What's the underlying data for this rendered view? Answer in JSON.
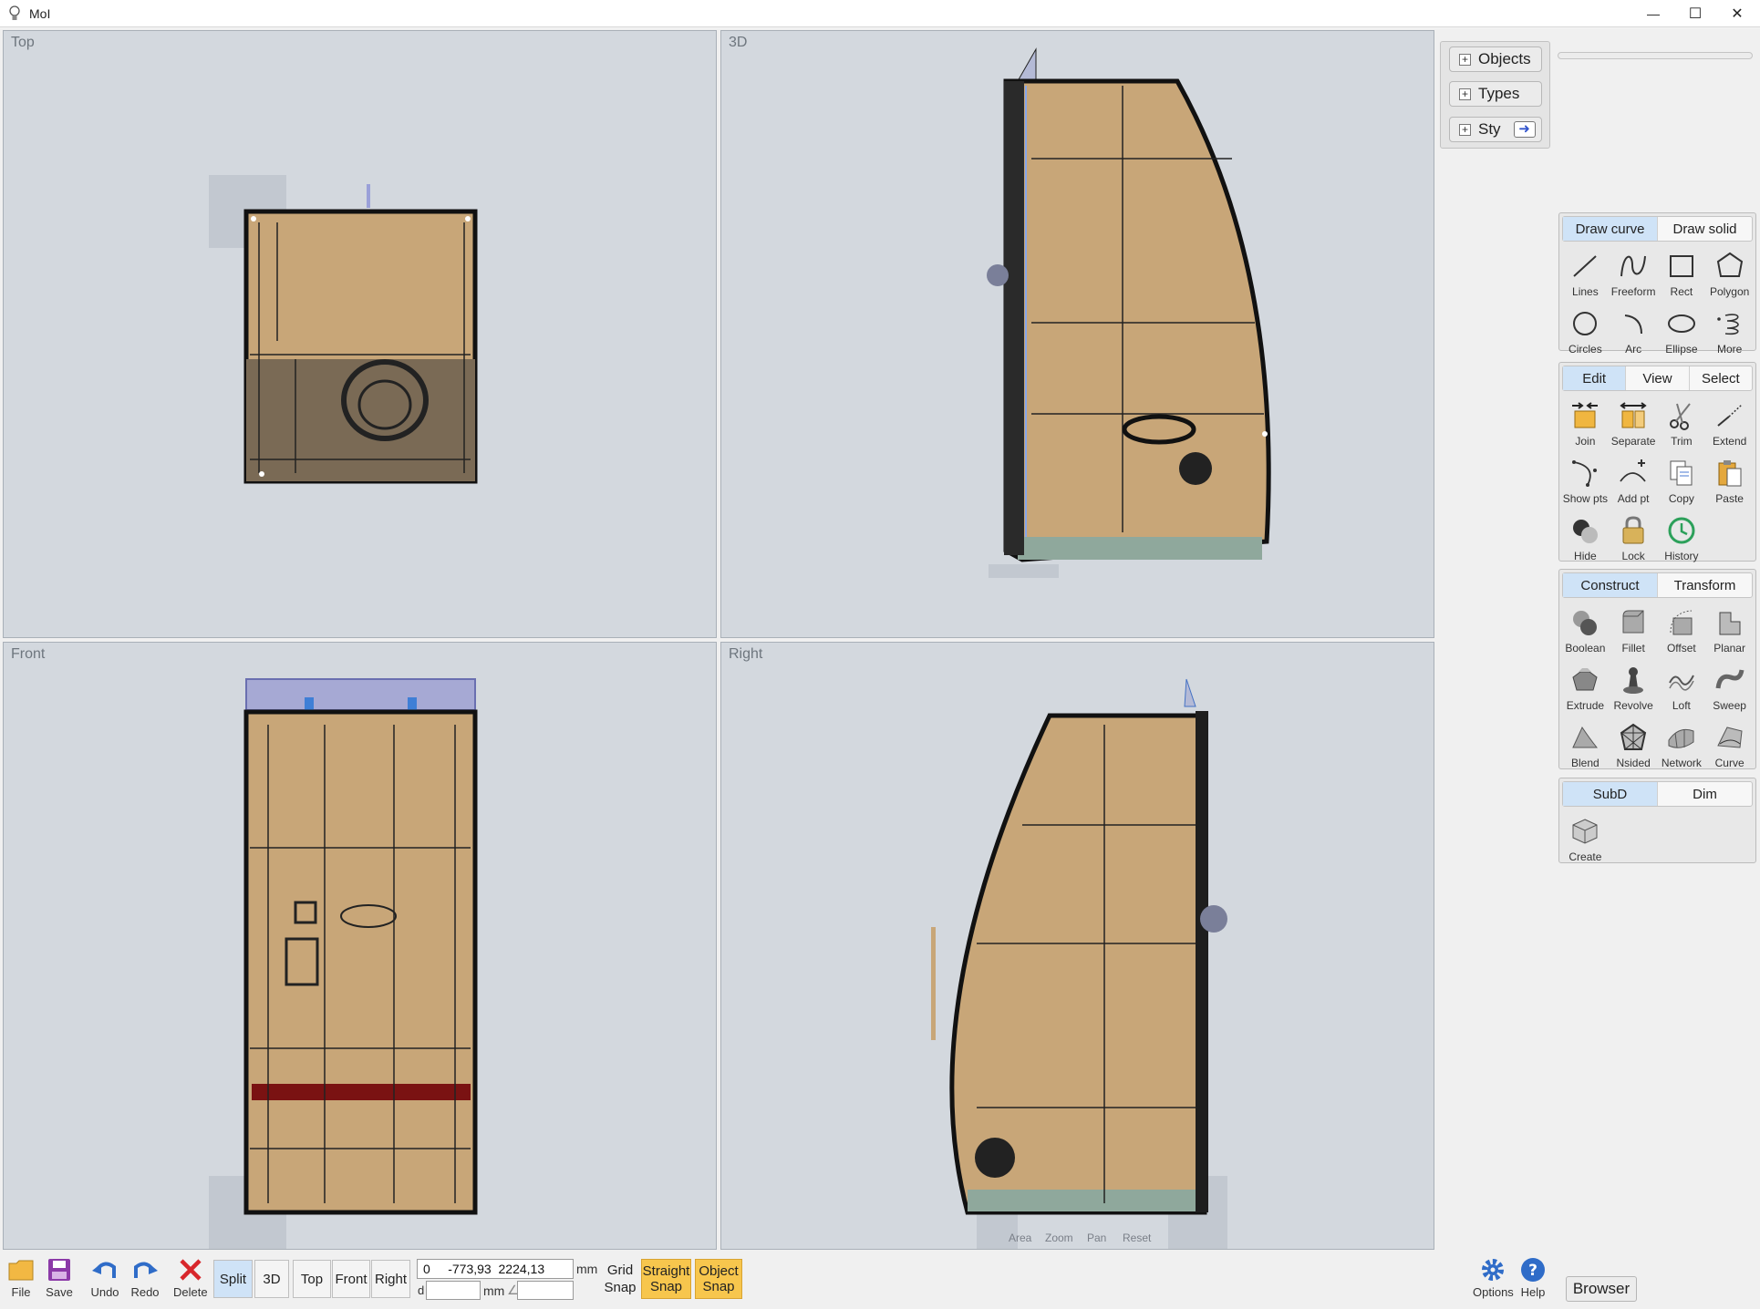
{
  "app": {
    "title": "MoI"
  },
  "window_controls": {
    "minimize": "—",
    "maximize": "☐",
    "close": "✕"
  },
  "viewports": {
    "top": {
      "label": "Top"
    },
    "perspective": {
      "label": "3D"
    },
    "front": {
      "label": "Front"
    },
    "right": {
      "label": "Right"
    }
  },
  "nav_hints": {
    "area": "Area",
    "zoom": "Zoom",
    "pan": "Pan",
    "reset": "Reset"
  },
  "scene_browser": {
    "objects": "Objects",
    "types": "Types",
    "styles": "Sty"
  },
  "draw_palette": {
    "tabs": [
      "Draw curve",
      "Draw solid"
    ],
    "active_tab": "Draw curve",
    "tools": [
      "Lines",
      "Freeform",
      "Rect",
      "Polygon",
      "Circles",
      "Arc",
      "Ellipse",
      "More"
    ]
  },
  "edit_palette": {
    "tabs": [
      "Edit",
      "View",
      "Select"
    ],
    "active_tab": "Edit",
    "tools": [
      "Join",
      "Separate",
      "Trim",
      "Extend",
      "Show pts",
      "Add pt",
      "Copy",
      "Paste",
      "Hide",
      "Lock",
      "History"
    ]
  },
  "construct_palette": {
    "tabs": [
      "Construct",
      "Transform"
    ],
    "active_tab": "Construct",
    "tools": [
      "Boolean",
      "Fillet",
      "Offset",
      "Planar",
      "Extrude",
      "Revolve",
      "Loft",
      "Sweep",
      "Blend",
      "Nsided",
      "Network",
      "Curve"
    ]
  },
  "subd_palette": {
    "tabs": [
      "SubD",
      "Dim"
    ],
    "active_tab": "SubD",
    "tools": [
      "Create"
    ]
  },
  "bottom_toolbar": {
    "file": "File",
    "save": "Save",
    "undo": "Undo",
    "redo": "Redo",
    "delete": "Delete",
    "views": [
      "Split",
      "3D",
      "Top",
      "Front",
      "Right"
    ],
    "active_view": "Split",
    "coordinate_value": "0     -773,93  2224,13",
    "coordinate_unit": "mm",
    "distance_prefix": "d",
    "distance_unit": "mm",
    "angle_symbol": "∠",
    "grid_snap_line1": "Grid",
    "grid_snap_line2": "Snap",
    "straight_snap_line1": "Straight",
    "straight_snap_line2": "Snap",
    "object_snap_line1": "Object",
    "object_snap_line2": "Snap",
    "options": "Options",
    "help": "Help",
    "browser": "Browser"
  },
  "colors": {
    "viewport_bg": "#d3d8de",
    "model_fill": "#c8a678",
    "accent_active": "#cfe3f7",
    "snap_active": "#f7c64d"
  }
}
